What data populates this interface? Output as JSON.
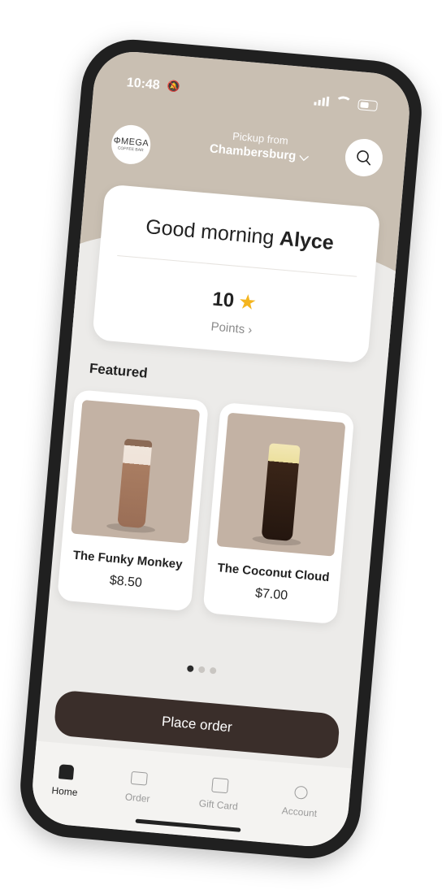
{
  "status_bar": {
    "time": "10:48",
    "bell": "🔕"
  },
  "header": {
    "logo_name": "ΦMEGA",
    "logo_sub": "COFFEE BAR",
    "pickup_label": "Pickup from",
    "pickup_location": "Chambersburg ⌵"
  },
  "greeting": {
    "prefix": "Good morning ",
    "name": "Alyce",
    "points_value": "10",
    "points_label": "Points  ›"
  },
  "featured": {
    "title": "Featured",
    "products": [
      {
        "name": "The Funky Monkey",
        "price": "$8.50"
      },
      {
        "name": "The Coconut Cloud",
        "price": "$7.00"
      }
    ]
  },
  "carousel": {
    "total": 3,
    "active_index": 0
  },
  "cta": {
    "label": "Place order"
  },
  "tabs": [
    {
      "label": "Home",
      "icon": "home-icon",
      "active": true
    },
    {
      "label": "Order",
      "icon": "cart-icon",
      "active": false
    },
    {
      "label": "Gift Card",
      "icon": "gift-icon",
      "active": false
    },
    {
      "label": "Account",
      "icon": "account-icon",
      "active": false
    }
  ],
  "colors": {
    "header_bg": "#c9bfb2",
    "cta_bg": "#3a2e2a",
    "star": "#f4b51f",
    "screen_bg": "#ecebe9"
  }
}
